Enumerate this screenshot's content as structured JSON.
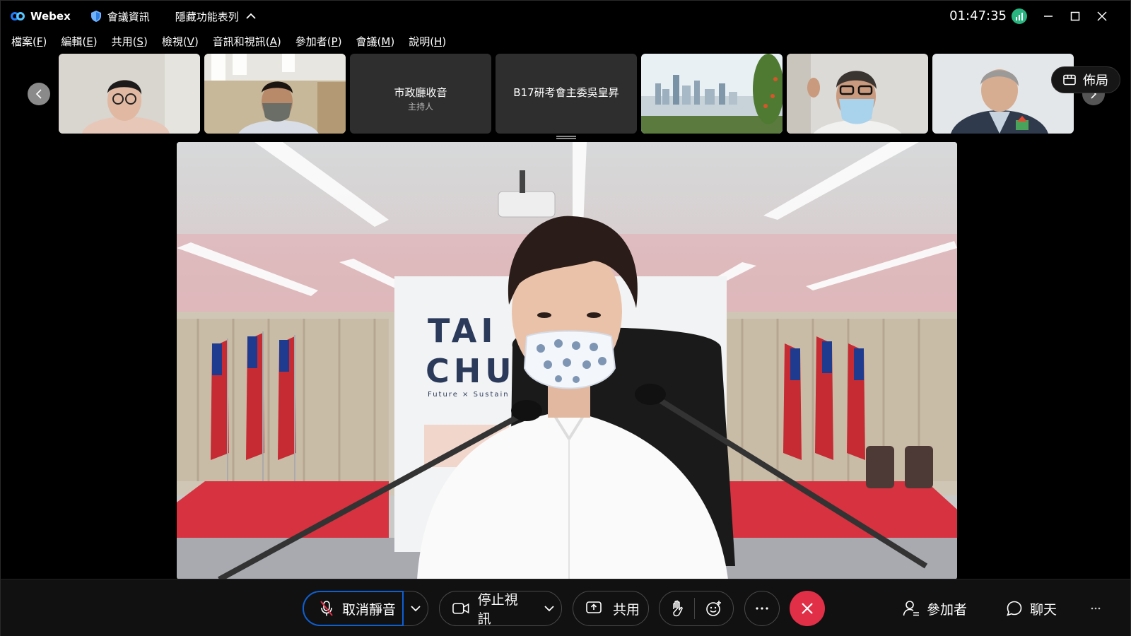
{
  "titlebar": {
    "app_name": "Webex",
    "meeting_info_label": "會議資訊",
    "hide_menu_label": "隱藏功能表列",
    "clock": "01:47:35"
  },
  "menu": [
    {
      "text": "檔案(",
      "key": "F",
      "tail": ")"
    },
    {
      "text": "編輯(",
      "key": "E",
      "tail": ")"
    },
    {
      "text": "共用(",
      "key": "S",
      "tail": ")"
    },
    {
      "text": "檢視(",
      "key": "V",
      "tail": ")"
    },
    {
      "text": "音訊和視訊(",
      "key": "A",
      "tail": ")"
    },
    {
      "text": "參加者(",
      "key": "P",
      "tail": ")"
    },
    {
      "text": "會議(",
      "key": "M",
      "tail": ")"
    },
    {
      "text": "說明(",
      "key": "H",
      "tail": ")"
    }
  ],
  "thumbnails": {
    "tile3_name": "市政廳收音",
    "tile3_role": "主持人",
    "tile4_name": "B17研考會主委吳皇昇"
  },
  "layout_button": "佈局",
  "main_video": {
    "backdrop_line1": "TAI",
    "backdrop_line2": "CHU",
    "backdrop_tagline": "Future × Sustain"
  },
  "controls": {
    "unmute": "取消靜音",
    "stop_video": "停止視訊",
    "share": "共用",
    "participants": "參加者",
    "chat": "聊天"
  },
  "colors": {
    "accent_blue": "#0d5fd4",
    "end_red": "#e12f47",
    "signal_green": "#29b481"
  }
}
